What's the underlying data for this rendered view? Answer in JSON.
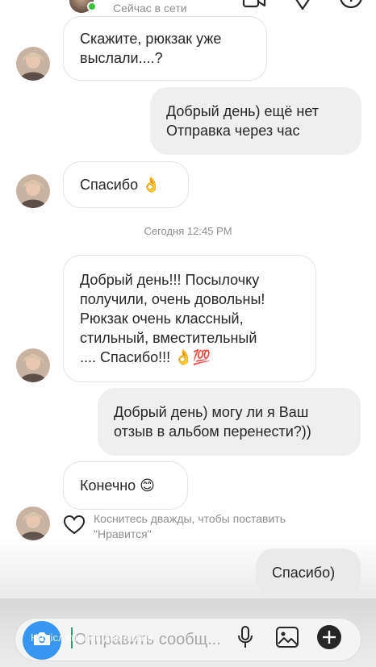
{
  "header": {
    "status": "Сейчас в сети"
  },
  "messages": {
    "m1": "Скажите, рюкзак уже\nвыслали....?",
    "m2": "Добрый день) ещё нет\nОтправка через час",
    "m3": "Спасибо 👌",
    "m4": "Добрый день!!! Посылочку\nполучили, очень довольны!\nРюкзак очень классный,\nстильный, вместительный\n.... Спасибо!!! 👌💯",
    "m5": "Добрый день) могу ли я Ваш\nотзыв в альбом перенести?))",
    "m6": "Конечно 😊",
    "m7": "Спасибо)"
  },
  "timestamp": "Сегодня 12:45 PM",
  "like_hint": "Коснитесь дважды, чтобы поставить \"Нравится\"",
  "composer": {
    "placeholder": "Отправить сообщ...",
    "overlay_label": "Надіслати повідомлення"
  },
  "colors": {
    "accent": "#3797f0",
    "incoming_border": "#e3e3e3",
    "outgoing_bg": "#efefef",
    "online": "#3ec23e"
  },
  "icons": [
    "video-icon",
    "paper-plane-icon",
    "info-icon",
    "heart-icon",
    "camera-icon",
    "microphone-icon",
    "gallery-icon",
    "plus-icon"
  ]
}
